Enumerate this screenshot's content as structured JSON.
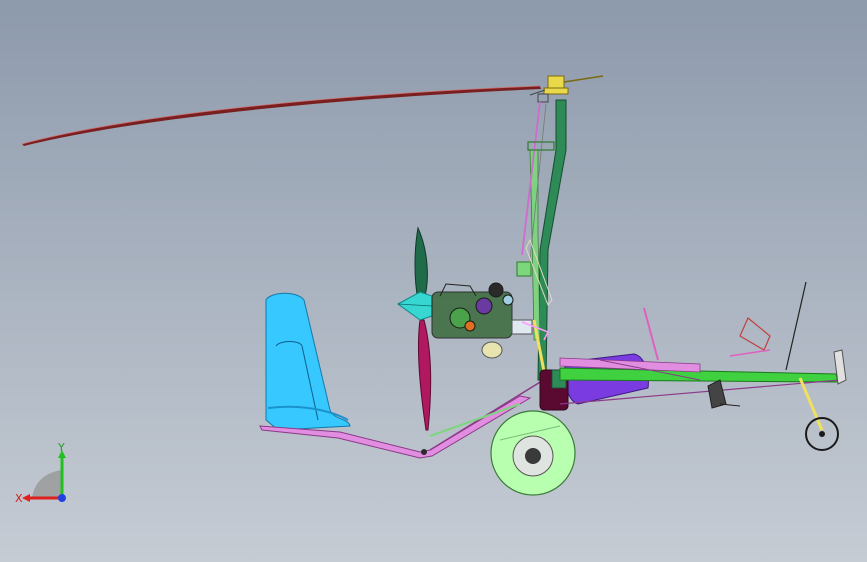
{
  "viewport": {
    "background_top": "#8d9aac",
    "background_bottom": "#c6ccd4"
  },
  "model": {
    "subject": "autogyro",
    "part_colors": {
      "rotor_blade": "#7a1f1f",
      "rotor_head": "#e8d84a",
      "mast": "#2e8b57",
      "mast_tube": "#7cd67c",
      "engine": "#3a6a3a",
      "propeller": "#1f6b4a",
      "propeller_blade": "#b01860",
      "spinner": "#38d6d0",
      "seat": "#36c8ff",
      "frame_lower": "#e28ee0",
      "fuel_tank": "#7a3ce0",
      "keel_beam": "#3fd13f",
      "main_wheel": "#b8ffb0",
      "nose_wheel": "#1a1a1a",
      "strut": "#f0e060",
      "control_stick": "#e060c0",
      "antenna": "#222222"
    }
  },
  "triad": {
    "x_label": "X",
    "y_label": "Y",
    "x_color": "#e02020",
    "y_color": "#20c020",
    "z_color": "#2040e0"
  }
}
